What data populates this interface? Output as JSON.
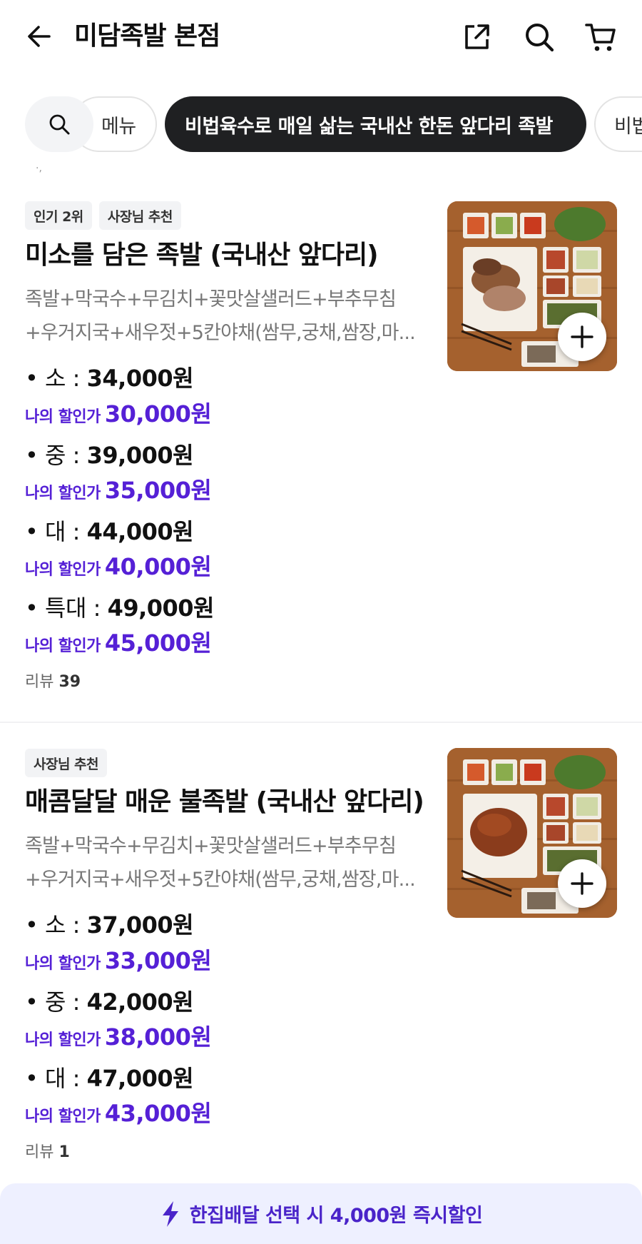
{
  "header": {
    "title": "미담족발 본점"
  },
  "categories": {
    "items": [
      "메뉴",
      "비법육수로 매일 삶는 국내산 한돈 앞다리 족발",
      "비법"
    ],
    "active_index": 1
  },
  "menu_items": [
    {
      "badges": [
        "인기 2위",
        "사장님 추천"
      ],
      "name": "미소를 담은 족발 (국내산 앞다리)",
      "desc_line1": "족발+막국수+무김치+꽃맛살샐러드+부추무침",
      "desc_line2": "+우거지국+새우젓+5칸야채(쌈무,궁채,쌈장,마...",
      "prices": [
        {
          "size": "• 소 : ",
          "price": "34,000원",
          "disc_label": "나의 할인가",
          "disc_price": "30,000원"
        },
        {
          "size": "• 중 : ",
          "price": "39,000원",
          "disc_label": "나의 할인가",
          "disc_price": "35,000원"
        },
        {
          "size": "• 대 : ",
          "price": "44,000원",
          "disc_label": "나의 할인가",
          "disc_price": "40,000원"
        },
        {
          "size": "• 특대 : ",
          "price": "49,000원",
          "disc_label": "나의 할인가",
          "disc_price": "45,000원"
        }
      ],
      "review_label": "리뷰",
      "review_count": "39"
    },
    {
      "badges": [
        "사장님 추천"
      ],
      "name": "매콤달달 매운 불족발 (국내산 앞다리)",
      "desc_line1": "족발+막국수+무김치+꽃맛살샐러드+부추무침",
      "desc_line2": "+우거지국+새우젓+5칸야채(쌈무,궁채,쌈장,마...",
      "prices": [
        {
          "size": "• 소 : ",
          "price": "37,000원",
          "disc_label": "나의 할인가",
          "disc_price": "33,000원"
        },
        {
          "size": "• 중 : ",
          "price": "42,000원",
          "disc_label": "나의 할인가",
          "disc_price": "38,000원"
        },
        {
          "size": "• 대 : ",
          "price": "47,000원",
          "disc_label": "나의 할인가",
          "disc_price": "43,000원"
        }
      ],
      "review_label": "리뷰",
      "review_count": "1"
    }
  ],
  "banner": {
    "icon": "lightning-icon",
    "text": "한집배달 선택 시 4,000원 즉시할인"
  },
  "colors": {
    "accent": "#5520d6",
    "active_chip": "#1f2022",
    "banner_bg": "#eef0ff"
  }
}
